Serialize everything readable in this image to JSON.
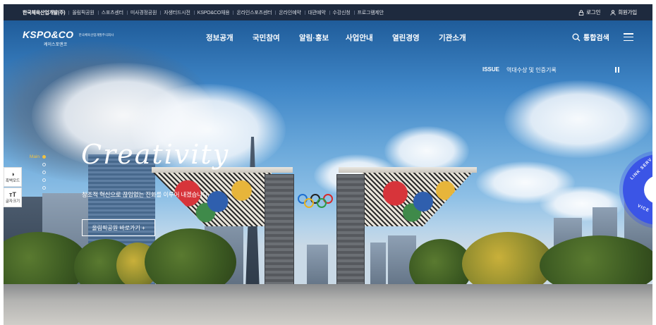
{
  "topbar": {
    "links": [
      "한국체육산업개발(주)",
      "올림픽공원",
      "스포츠센터",
      "미사경정공원",
      "자생터드시전",
      "KSPO&CO채용",
      "온라인스포츠센터",
      "온라인예약",
      "대관예약",
      "수강신청",
      "프로그램제안"
    ],
    "login": "로그인",
    "signup": "회원가입"
  },
  "nav": {
    "logo_main": "KSPO&CO",
    "logo_sub": "한국체육산업개발주식회사",
    "logo_kr": "케이스포앤코",
    "menu": [
      "정보공개",
      "국민참여",
      "알림·홍보",
      "사업안내",
      "열린경영",
      "기관소개"
    ],
    "search_label": "통합검색"
  },
  "issue": {
    "tag": "ISSUE",
    "text": "역대수상 및 인증기록"
  },
  "hero": {
    "slogan": "Creativity",
    "description": "창조적 혁신으로 끊임없는 진화를 이루어 내겠습니다.",
    "cta": "올림픽공원 바로가기 +",
    "pager_label": "Main"
  },
  "sidetools": {
    "contrast_label": "흑백모드",
    "font_label": "글자크기"
  },
  "link_service": {
    "top": "LINK SERV",
    "bottom": "VICE"
  },
  "colors": {
    "topbar_bg": "#1e2a3e",
    "accent_yellow": "#f0c040",
    "link_blue": "#3b55e6"
  }
}
